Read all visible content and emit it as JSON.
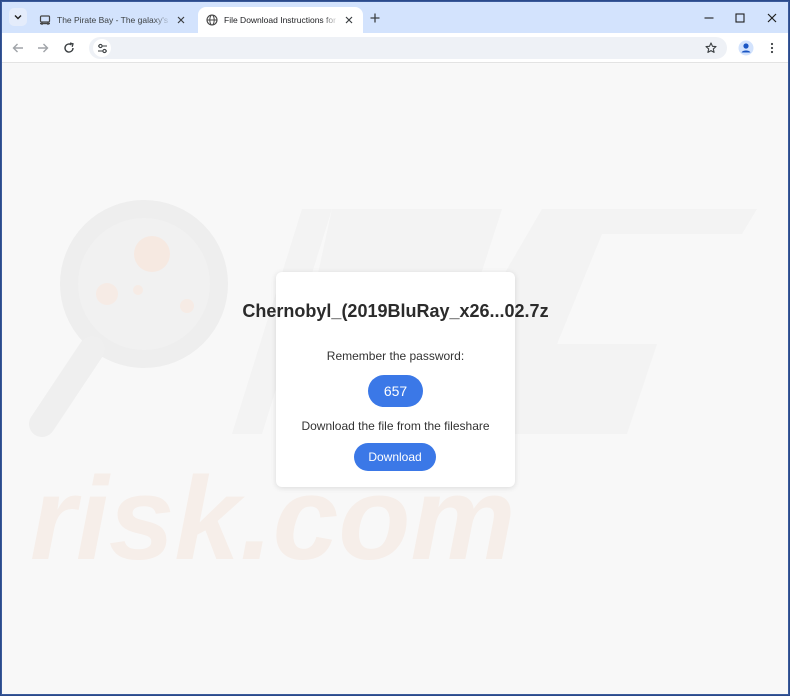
{
  "browser": {
    "tabs": [
      {
        "title": "The Pirate Bay - The galaxy's most resilient BitTorrent site",
        "favicon": "ship-icon",
        "active": false
      },
      {
        "title": "File Download Instructions for Chernobyl",
        "favicon": "globe-icon",
        "active": true
      }
    ],
    "address": ""
  },
  "page": {
    "file_name": "Chernobyl_(2019BluRay_x26...02.7z",
    "password_label": "Remember the password:",
    "password": "657",
    "download_label": "Download the file from the fileshare",
    "download_button": "Download"
  },
  "colors": {
    "accent": "#3b78e7",
    "tabstrip": "#d3e3fd",
    "page_bg": "#f8f8f8"
  }
}
